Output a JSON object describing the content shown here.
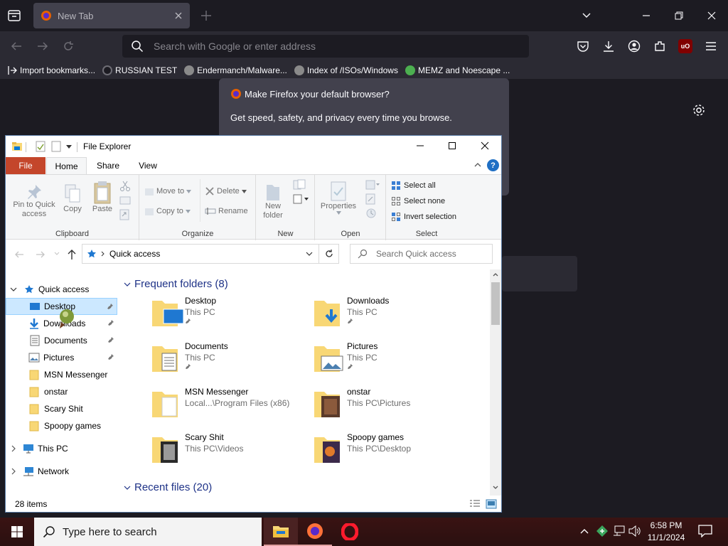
{
  "firefox": {
    "tab_title": "New Tab",
    "address_placeholder": "Search with Google or enter address",
    "bookmarks": [
      {
        "label": "Import bookmarks...",
        "color": "#fbfbfe"
      },
      {
        "label": "RUSSIAN TEST",
        "color": "#3a3a3a"
      },
      {
        "label": "Endermanch/Malware...",
        "color": "#8a8a8a"
      },
      {
        "label": "Index of /ISOs/Windows",
        "color": "#8a8a8a"
      },
      {
        "label": "MEMZ and Noescape ...",
        "color": "#4caf50"
      }
    ],
    "notification": {
      "title": "Make Firefox your default browser?",
      "body": "Get speed, safety, and privacy every time you browse."
    },
    "ublock_label": "uO"
  },
  "explorer": {
    "title": "File Explorer",
    "tabs": {
      "file": "File",
      "home": "Home",
      "share": "Share",
      "view": "View"
    },
    "help": "?",
    "ribbon": {
      "pin": "Pin to Quick access",
      "copy": "Copy",
      "paste": "Paste",
      "clipboard": "Clipboard",
      "move_to": "Move to",
      "copy_to": "Copy to",
      "delete": "Delete",
      "rename": "Rename",
      "organize": "Organize",
      "new_folder": "New folder",
      "new": "New",
      "properties": "Properties",
      "open": "Open",
      "select_all": "Select all",
      "select_none": "Select none",
      "invert_selection": "Invert selection",
      "select": "Select"
    },
    "address": {
      "location": "Quick access"
    },
    "search_placeholder": "Search Quick access",
    "nav": {
      "quick_access": "Quick access",
      "items": [
        {
          "label": "Desktop",
          "pinned": true
        },
        {
          "label": "Downloads",
          "pinned": true
        },
        {
          "label": "Documents",
          "pinned": true
        },
        {
          "label": "Pictures",
          "pinned": true
        },
        {
          "label": "MSN Messenger",
          "pinned": false
        },
        {
          "label": "onstar",
          "pinned": false
        },
        {
          "label": "Scary Shit",
          "pinned": false
        },
        {
          "label": "Spoopy games",
          "pinned": false
        }
      ],
      "this_pc": "This PC",
      "network": "Network"
    },
    "frequent_header": "Frequent folders (8)",
    "recent_header": "Recent files (20)",
    "folders": [
      {
        "name": "Desktop",
        "location": "This PC",
        "pinned": true
      },
      {
        "name": "Downloads",
        "location": "This PC",
        "pinned": true
      },
      {
        "name": "Documents",
        "location": "This PC",
        "pinned": true
      },
      {
        "name": "Pictures",
        "location": "This PC",
        "pinned": true
      },
      {
        "name": "MSN Messenger",
        "location": "Local...\\Program Files (x86)",
        "pinned": false
      },
      {
        "name": "onstar",
        "location": "This PC\\Pictures",
        "pinned": false
      },
      {
        "name": "Scary Shit",
        "location": "This PC\\Videos",
        "pinned": false
      },
      {
        "name": "Spoopy games",
        "location": "This PC\\Desktop",
        "pinned": false
      }
    ],
    "status": "28 items"
  },
  "taskbar": {
    "search_placeholder": "Type here to search",
    "time": "6:58 PM",
    "date": "11/1/2024"
  },
  "colors": {
    "file_tab": "#c4462b",
    "selection": "#cce8ff",
    "accent": "#0078d7",
    "folder": "#f8d775"
  }
}
